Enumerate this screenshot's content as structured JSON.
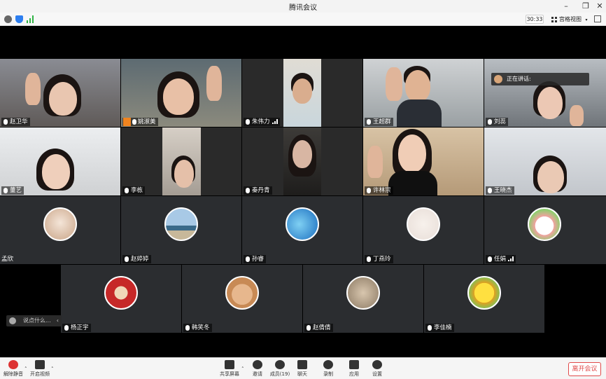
{
  "window": {
    "title": "腾讯会议"
  },
  "infobar": {
    "timer": "30:33",
    "view_label": "宫格视图"
  },
  "speaking": {
    "label": "正在讲话:"
  },
  "participants": [
    "赵卫华",
    "姚淑美",
    "朱伟力",
    "王超群",
    "刘蕊",
    "董艺",
    "李栋",
    "秦丹青",
    "许林宗",
    "王晓杰",
    "孟欣",
    "赵婷婷",
    "孙睿",
    "丁燕玲",
    "任娟",
    "杨正宇",
    "韩笑冬",
    "赵倩倩",
    "李佳楠"
  ],
  "chat": {
    "placeholder": "说点什么..."
  },
  "toolbar": {
    "mute": "解除静音",
    "video": "开启视频",
    "share": "共享屏幕",
    "invite": "邀请",
    "members": "成员(19)",
    "chat": "聊天",
    "record": "录制",
    "apps": "应用",
    "settings": "设置",
    "leave": "离开会议"
  },
  "colors": {
    "leave": "#e04a4a",
    "tile_bg": "#2b2d30",
    "stage_bg": "#000000"
  }
}
